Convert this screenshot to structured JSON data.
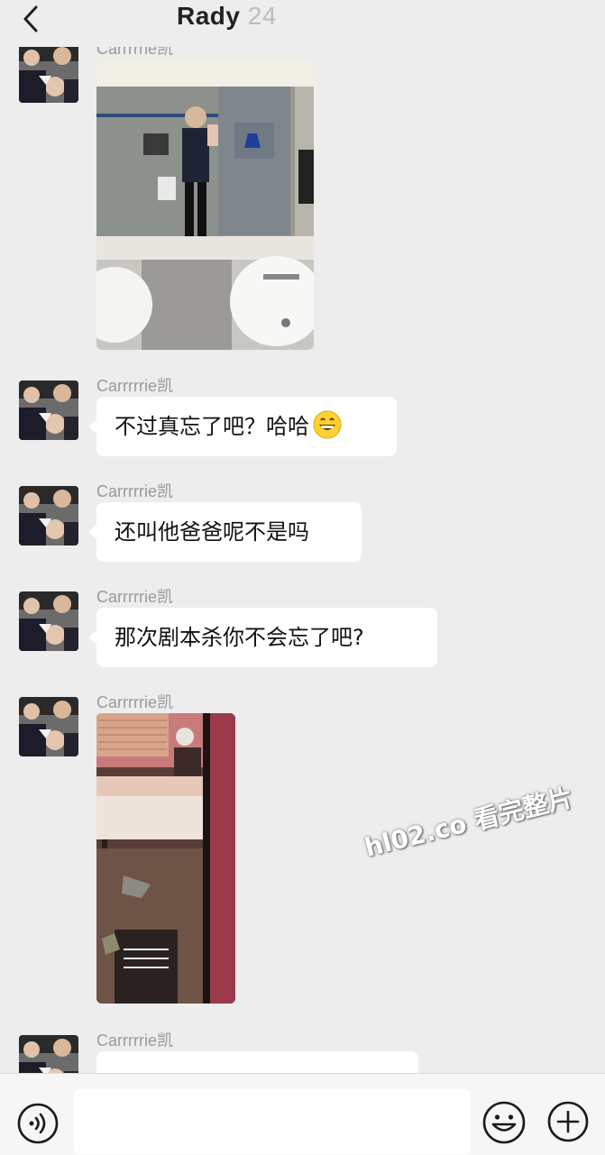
{
  "header": {
    "title": "Rady",
    "title_faded": "24"
  },
  "messages": [
    {
      "sender": "Carrrrrie凯",
      "type": "image",
      "description": "mirror-selfie-restroom"
    },
    {
      "sender": "Carrrrrie凯",
      "type": "text",
      "text": "不过真忘了吧？哈哈",
      "emoji": "grinning-face-icon"
    },
    {
      "sender": "Carrrrrie凯",
      "type": "text",
      "text": "还叫他爸爸呢不是吗"
    },
    {
      "sender": "Carrrrrie凯",
      "type": "text",
      "text": "那次剧本杀你不会忘了吧?"
    },
    {
      "sender": "Carrrrrie凯",
      "type": "image",
      "description": "dim-bedroom-photo"
    },
    {
      "sender": "Carrrrrie凯",
      "type": "text",
      "text": ""
    }
  ],
  "watermark": "hl02.co 看完整片",
  "bottom_bar": {
    "input_value": "",
    "icons": [
      "voice-icon",
      "emoji-icon",
      "plus-icon"
    ]
  },
  "colors": {
    "background": "#ededed",
    "bubble": "#ffffff",
    "sender_name": "#9a9a9a"
  }
}
